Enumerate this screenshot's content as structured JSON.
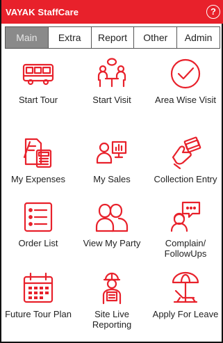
{
  "app": {
    "title": "VAYAK StaffCare",
    "help_glyph": "?"
  },
  "tabs": [
    {
      "label": "Main",
      "active": true
    },
    {
      "label": "Extra",
      "active": false
    },
    {
      "label": "Report",
      "active": false
    },
    {
      "label": "Other",
      "active": false
    },
    {
      "label": "Admin",
      "active": false
    }
  ],
  "menu": [
    {
      "label": "Start Tour",
      "icon": "bus-icon"
    },
    {
      "label": "Start Visit",
      "icon": "meeting-icon"
    },
    {
      "label": "Area Wise Visit",
      "icon": "check-circle-icon"
    },
    {
      "label": "My Expenses",
      "icon": "expense-calculator-icon"
    },
    {
      "label": "My Sales",
      "icon": "presenter-chart-icon"
    },
    {
      "label": "Collection Entry",
      "icon": "cash-hand-icon"
    },
    {
      "label": "Order List",
      "icon": "checklist-icon"
    },
    {
      "label": "View My Party",
      "icon": "people-icon"
    },
    {
      "label": "Complain/ FollowUps",
      "icon": "support-chat-icon"
    },
    {
      "label": "Future Tour Plan",
      "icon": "calendar-icon"
    },
    {
      "label": "Site Live Reporting",
      "icon": "worker-icon"
    },
    {
      "label": "Apply For Leave",
      "icon": "beach-chair-icon"
    }
  ],
  "colors": {
    "accent": "#e8212b",
    "tab_active_bg": "#8a8a8a",
    "icon": "#e8212b"
  }
}
